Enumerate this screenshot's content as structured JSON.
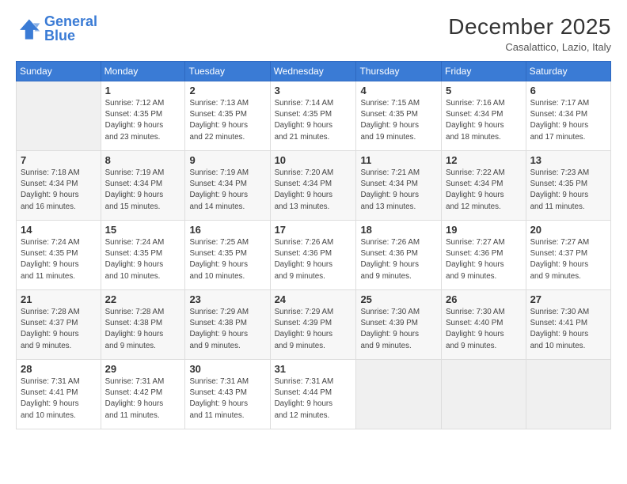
{
  "logo": {
    "line1": "General",
    "line2": "Blue"
  },
  "title": "December 2025",
  "location": "Casalattico, Lazio, Italy",
  "days_header": [
    "Sunday",
    "Monday",
    "Tuesday",
    "Wednesday",
    "Thursday",
    "Friday",
    "Saturday"
  ],
  "weeks": [
    [
      {
        "num": "",
        "info": ""
      },
      {
        "num": "1",
        "info": "Sunrise: 7:12 AM\nSunset: 4:35 PM\nDaylight: 9 hours\nand 23 minutes."
      },
      {
        "num": "2",
        "info": "Sunrise: 7:13 AM\nSunset: 4:35 PM\nDaylight: 9 hours\nand 22 minutes."
      },
      {
        "num": "3",
        "info": "Sunrise: 7:14 AM\nSunset: 4:35 PM\nDaylight: 9 hours\nand 21 minutes."
      },
      {
        "num": "4",
        "info": "Sunrise: 7:15 AM\nSunset: 4:35 PM\nDaylight: 9 hours\nand 19 minutes."
      },
      {
        "num": "5",
        "info": "Sunrise: 7:16 AM\nSunset: 4:34 PM\nDaylight: 9 hours\nand 18 minutes."
      },
      {
        "num": "6",
        "info": "Sunrise: 7:17 AM\nSunset: 4:34 PM\nDaylight: 9 hours\nand 17 minutes."
      }
    ],
    [
      {
        "num": "7",
        "info": "Sunrise: 7:18 AM\nSunset: 4:34 PM\nDaylight: 9 hours\nand 16 minutes."
      },
      {
        "num": "8",
        "info": "Sunrise: 7:19 AM\nSunset: 4:34 PM\nDaylight: 9 hours\nand 15 minutes."
      },
      {
        "num": "9",
        "info": "Sunrise: 7:19 AM\nSunset: 4:34 PM\nDaylight: 9 hours\nand 14 minutes."
      },
      {
        "num": "10",
        "info": "Sunrise: 7:20 AM\nSunset: 4:34 PM\nDaylight: 9 hours\nand 13 minutes."
      },
      {
        "num": "11",
        "info": "Sunrise: 7:21 AM\nSunset: 4:34 PM\nDaylight: 9 hours\nand 13 minutes."
      },
      {
        "num": "12",
        "info": "Sunrise: 7:22 AM\nSunset: 4:34 PM\nDaylight: 9 hours\nand 12 minutes."
      },
      {
        "num": "13",
        "info": "Sunrise: 7:23 AM\nSunset: 4:35 PM\nDaylight: 9 hours\nand 11 minutes."
      }
    ],
    [
      {
        "num": "14",
        "info": "Sunrise: 7:24 AM\nSunset: 4:35 PM\nDaylight: 9 hours\nand 11 minutes."
      },
      {
        "num": "15",
        "info": "Sunrise: 7:24 AM\nSunset: 4:35 PM\nDaylight: 9 hours\nand 10 minutes."
      },
      {
        "num": "16",
        "info": "Sunrise: 7:25 AM\nSunset: 4:35 PM\nDaylight: 9 hours\nand 10 minutes."
      },
      {
        "num": "17",
        "info": "Sunrise: 7:26 AM\nSunset: 4:36 PM\nDaylight: 9 hours\nand 9 minutes."
      },
      {
        "num": "18",
        "info": "Sunrise: 7:26 AM\nSunset: 4:36 PM\nDaylight: 9 hours\nand 9 minutes."
      },
      {
        "num": "19",
        "info": "Sunrise: 7:27 AM\nSunset: 4:36 PM\nDaylight: 9 hours\nand 9 minutes."
      },
      {
        "num": "20",
        "info": "Sunrise: 7:27 AM\nSunset: 4:37 PM\nDaylight: 9 hours\nand 9 minutes."
      }
    ],
    [
      {
        "num": "21",
        "info": "Sunrise: 7:28 AM\nSunset: 4:37 PM\nDaylight: 9 hours\nand 9 minutes."
      },
      {
        "num": "22",
        "info": "Sunrise: 7:28 AM\nSunset: 4:38 PM\nDaylight: 9 hours\nand 9 minutes."
      },
      {
        "num": "23",
        "info": "Sunrise: 7:29 AM\nSunset: 4:38 PM\nDaylight: 9 hours\nand 9 minutes."
      },
      {
        "num": "24",
        "info": "Sunrise: 7:29 AM\nSunset: 4:39 PM\nDaylight: 9 hours\nand 9 minutes."
      },
      {
        "num": "25",
        "info": "Sunrise: 7:30 AM\nSunset: 4:39 PM\nDaylight: 9 hours\nand 9 minutes."
      },
      {
        "num": "26",
        "info": "Sunrise: 7:30 AM\nSunset: 4:40 PM\nDaylight: 9 hours\nand 9 minutes."
      },
      {
        "num": "27",
        "info": "Sunrise: 7:30 AM\nSunset: 4:41 PM\nDaylight: 9 hours\nand 10 minutes."
      }
    ],
    [
      {
        "num": "28",
        "info": "Sunrise: 7:31 AM\nSunset: 4:41 PM\nDaylight: 9 hours\nand 10 minutes."
      },
      {
        "num": "29",
        "info": "Sunrise: 7:31 AM\nSunset: 4:42 PM\nDaylight: 9 hours\nand 11 minutes."
      },
      {
        "num": "30",
        "info": "Sunrise: 7:31 AM\nSunset: 4:43 PM\nDaylight: 9 hours\nand 11 minutes."
      },
      {
        "num": "31",
        "info": "Sunrise: 7:31 AM\nSunset: 4:44 PM\nDaylight: 9 hours\nand 12 minutes."
      },
      {
        "num": "",
        "info": ""
      },
      {
        "num": "",
        "info": ""
      },
      {
        "num": "",
        "info": ""
      }
    ]
  ]
}
